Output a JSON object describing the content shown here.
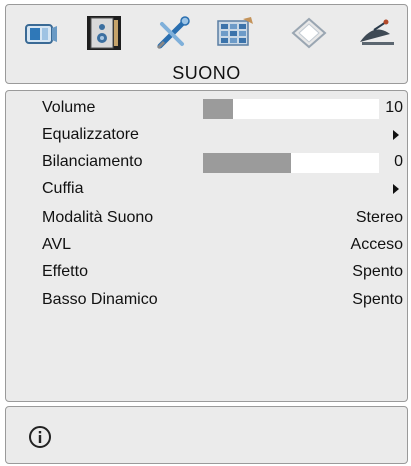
{
  "menu": {
    "title": "SUONO",
    "tabs": [
      {
        "icon": "tv-image-icon",
        "active": false
      },
      {
        "icon": "speaker-sound-icon",
        "active": true
      },
      {
        "icon": "settings-tools-icon",
        "active": false
      },
      {
        "icon": "channel-grid-icon",
        "active": false
      },
      {
        "icon": "source-input-icon",
        "active": false
      },
      {
        "icon": "satellite-dish-icon",
        "active": false
      }
    ]
  },
  "settings": {
    "volume": {
      "label": "Volume",
      "value": "10",
      "level": 0.17
    },
    "equalizer": {
      "label": "Equalizzatore"
    },
    "balance": {
      "label": "Bilanciamento",
      "value": "0",
      "level": 0.5
    },
    "headphone": {
      "label": "Cuffia"
    },
    "sound_mode": {
      "label": "Modalità Suono",
      "value": "Stereo"
    },
    "avl": {
      "label": "AVL",
      "value": "Acceso"
    },
    "effect": {
      "label": "Effetto",
      "value": "Spento"
    },
    "dynamic_bass": {
      "label": "Basso Dinamico",
      "value": "Spento"
    }
  },
  "footer": {
    "icon": "info-icon"
  },
  "colors": {
    "panel": "#ebebeb",
    "bar_fill": "#9b9b9b",
    "bar_track": "#ffffff",
    "border": "#9a9a9a"
  }
}
